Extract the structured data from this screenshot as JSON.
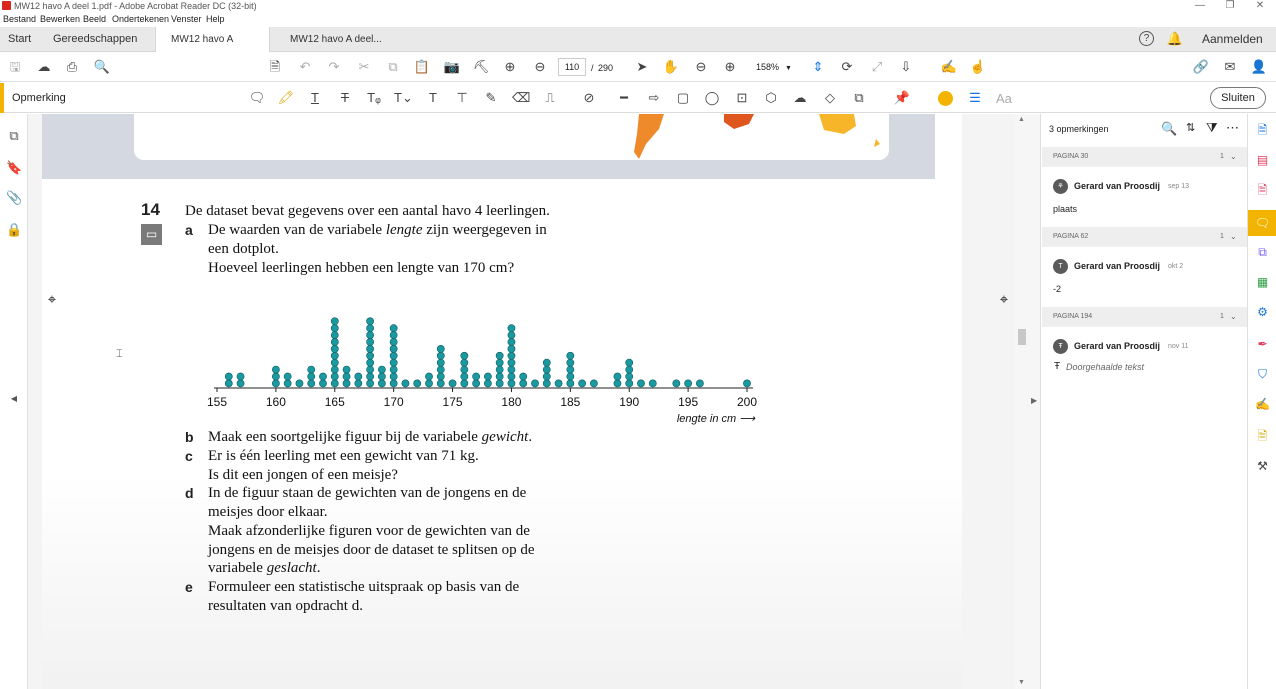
{
  "window": {
    "title": "MW12 havo A deel 1.pdf - Adobe Acrobat Reader DC (32-bit)"
  },
  "menu": [
    "Bestand",
    "Bewerken",
    "Beeld",
    "Ondertekenen",
    "Venster",
    "Help"
  ],
  "tabs": {
    "start": "Start",
    "tools": "Gereedschappen",
    "doc1": "MW12 havo A deel...",
    "doc1_close": "×",
    "doc2": "MW12 havo A deel...",
    "signin": "Aanmelden"
  },
  "toolbar": {
    "page_current": "110",
    "page_sep": "/",
    "page_total": "290",
    "zoom": "158%"
  },
  "annot_toolbar": {
    "label": "Opmerking",
    "close_label": "Sluiten",
    "highlight_color": "#f2b400",
    "text_tool_label": "Aa"
  },
  "document": {
    "question_number": "14",
    "intro": "De dataset bevat gegevens over een aantal havo 4 leerlingen.",
    "parts": {
      "a_letter": "a",
      "a_line1_pre": "De waarden van de variabele ",
      "a_line1_em": "lengte",
      "a_line1_post": " zijn weergegeven in",
      "a_line2": "een dotplot.",
      "a_line3": "Hoeveel leerlingen hebben een lengte van 170 cm?",
      "b_letter": "b",
      "b_line1_pre": "Maak een soortgelijke figuur bij de variabele ",
      "b_line1_em": "gewicht",
      "b_line1_post": ".",
      "c_letter": "c",
      "c_line1": "Er is één leerling met een gewicht van 71 kg.",
      "c_line2": "Is dit een jongen of een meisje?",
      "d_letter": "d",
      "d_line1": "In de figuur staan de gewichten van de jongens en de",
      "d_line2": "meisjes door elkaar.",
      "d_line3": "Maak afzonderlijke figuren voor de gewichten van de",
      "d_line4": "jongens en de meisjes door de dataset te splitsen op de",
      "d_line5_pre": "variabele ",
      "d_line5_em": "geslacht",
      "d_line5_post": ".",
      "e_letter": "e",
      "e_line1": "Formuleer een statistische uitspraak op basis van de",
      "e_line2": "resultaten van opdracht d."
    }
  },
  "chart_data": {
    "type": "scatter",
    "subtype": "dotplot",
    "xlabel": "lengte in cm",
    "xlim": [
      155,
      200
    ],
    "ticks": [
      155,
      160,
      165,
      170,
      175,
      180,
      185,
      190,
      195,
      200
    ],
    "dot_color": "#1a9aa0",
    "x": [
      156,
      157,
      160,
      161,
      162,
      163,
      164,
      165,
      166,
      167,
      168,
      169,
      170,
      171,
      172,
      173,
      174,
      175,
      176,
      177,
      178,
      179,
      180,
      181,
      182,
      183,
      184,
      185,
      186,
      187,
      189,
      190,
      191,
      192,
      194,
      195,
      196,
      200
    ],
    "counts": [
      2,
      2,
      3,
      2,
      1,
      3,
      2,
      10,
      3,
      2,
      10,
      3,
      9,
      1,
      1,
      2,
      6,
      1,
      5,
      2,
      2,
      5,
      9,
      2,
      1,
      4,
      1,
      5,
      1,
      1,
      2,
      4,
      1,
      1,
      1,
      1,
      1,
      1
    ]
  },
  "comments": {
    "count_label": "3 opmerkingen",
    "groups": [
      {
        "page": "PAGINA 30",
        "count": "1",
        "author": "Gerard van Proosdij",
        "date": "sep 13",
        "text": "plaats",
        "avatar": "⚘"
      },
      {
        "page": "PAGINA 62",
        "count": "1",
        "author": "Gerard van Proosdij",
        "date": "okt 2",
        "text": "-2",
        "avatar": "T"
      },
      {
        "page": "PAGINA 194",
        "count": "1",
        "author": "Gerard van Proosdij",
        "date": "nov 11",
        "text": "Doorgehaalde tekst",
        "avatar": "Ŧ"
      }
    ]
  }
}
